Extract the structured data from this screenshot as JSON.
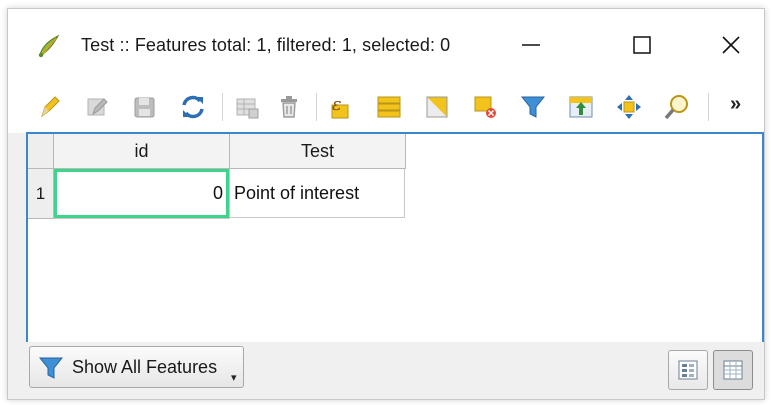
{
  "window": {
    "title": "Test :: Features total: 1, filtered: 1, selected: 0",
    "app_icon": "qgis-attribute-table-icon",
    "controls": {
      "minimize": "minimize-icon",
      "maximize": "maximize-icon",
      "close": "close-icon"
    }
  },
  "toolbar": {
    "items": [
      {
        "icon": "toggle-editing-pencil-icon"
      },
      {
        "icon": "multi-edit-icon"
      },
      {
        "icon": "save-edits-icon"
      },
      {
        "icon": "reload-icon"
      },
      {
        "icon": "add-feature-icon"
      },
      {
        "icon": "delete-feature-icon"
      },
      {
        "icon": "select-by-expression-icon"
      },
      {
        "icon": "select-all-icon"
      },
      {
        "icon": "invert-selection-icon"
      },
      {
        "icon": "deselect-all-icon"
      },
      {
        "icon": "filter-select-icon"
      },
      {
        "icon": "move-selection-to-top-icon"
      },
      {
        "icon": "pan-to-selected-icon"
      },
      {
        "icon": "zoom-to-selected-icon"
      }
    ],
    "overflow_label": "»"
  },
  "table": {
    "columns": [
      "id",
      "Test"
    ],
    "rows": [
      {
        "row_number": "1",
        "cells": [
          "0",
          "Point of interest"
        ]
      }
    ]
  },
  "bottom": {
    "show_features_label": "Show All Features",
    "dropdown_arrow": "▾",
    "view_buttons": [
      {
        "icon": "form-view-icon",
        "active": false
      },
      {
        "icon": "table-view-icon",
        "active": true
      }
    ]
  },
  "colors": {
    "table_border": "#3c86d0",
    "focus_cell": "#3fd48b",
    "toolbar_yellow": "#f2c31a",
    "reload_blue": "#2c6fb4"
  }
}
